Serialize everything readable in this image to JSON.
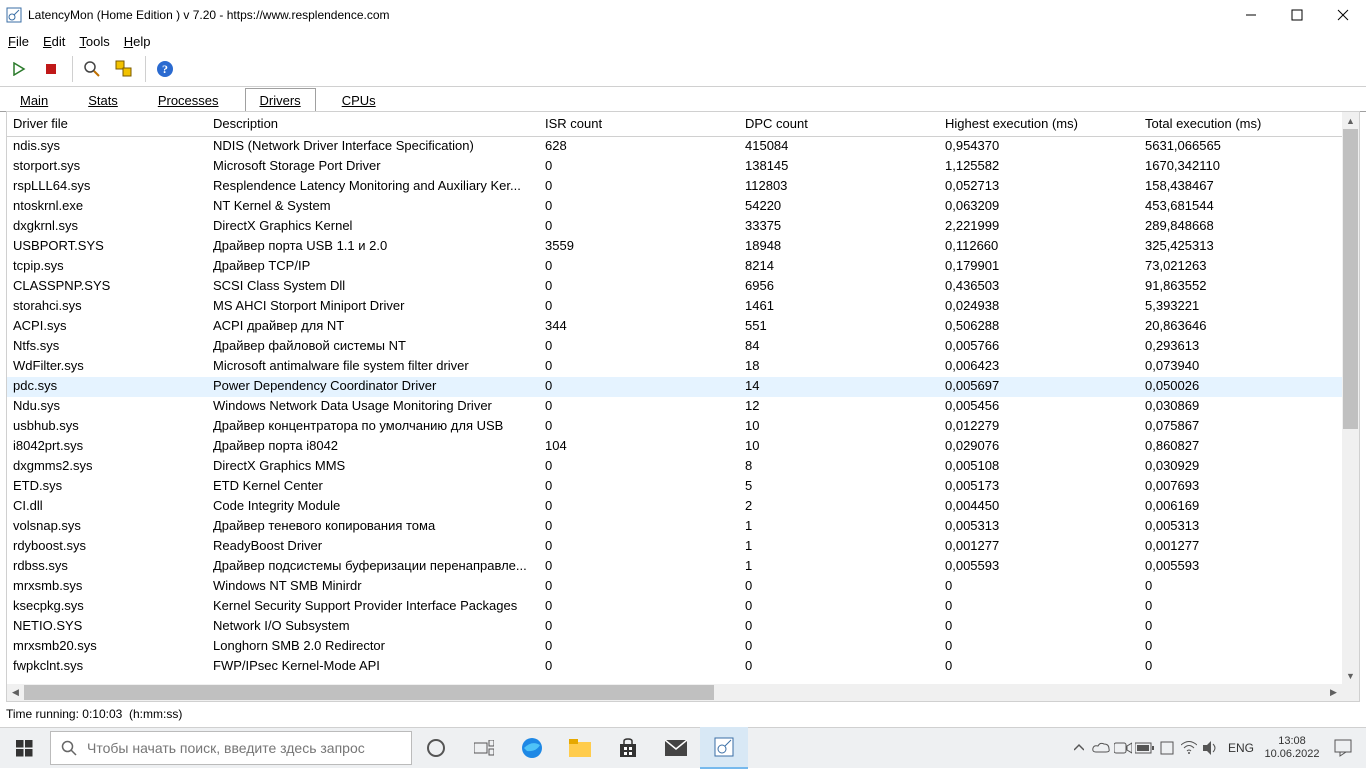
{
  "window": {
    "title": "LatencyMon  (Home Edition )  v 7.20 - https://www.resplendence.com"
  },
  "menu": {
    "items": [
      {
        "u": "F",
        "rest": "ile"
      },
      {
        "u": "E",
        "rest": "dit"
      },
      {
        "u": "T",
        "rest": "ools"
      },
      {
        "u": "H",
        "rest": "elp"
      }
    ]
  },
  "tabs": [
    {
      "label": "Main"
    },
    {
      "label": "Stats"
    },
    {
      "label": "Processes"
    },
    {
      "label": "Drivers"
    },
    {
      "label": "CPUs"
    }
  ],
  "active_tab": 3,
  "columns": [
    "Driver file",
    "Description",
    "ISR count",
    "DPC count",
    "Highest execution (ms)",
    "Total execution (ms)"
  ],
  "selected_row": 12,
  "rows": [
    [
      "ndis.sys",
      "NDIS (Network Driver Interface Specification)",
      "628",
      "415084",
      "0,954370",
      "5631,066565"
    ],
    [
      "storport.sys",
      "Microsoft Storage Port Driver",
      "0",
      "138145",
      "1,125582",
      "1670,342110"
    ],
    [
      "rspLLL64.sys",
      "Resplendence Latency Monitoring and Auxiliary Ker...",
      "0",
      "112803",
      "0,052713",
      "158,438467"
    ],
    [
      "ntoskrnl.exe",
      "NT Kernel & System",
      "0",
      "54220",
      "0,063209",
      "453,681544"
    ],
    [
      "dxgkrnl.sys",
      "DirectX Graphics Kernel",
      "0",
      "33375",
      "2,221999",
      "289,848668"
    ],
    [
      "USBPORT.SYS",
      "Драйвер порта USB 1.1 и 2.0",
      "3559",
      "18948",
      "0,112660",
      "325,425313"
    ],
    [
      "tcpip.sys",
      "Драйвер TCP/IP",
      "0",
      "8214",
      "0,179901",
      "73,021263"
    ],
    [
      "CLASSPNP.SYS",
      "SCSI Class System Dll",
      "0",
      "6956",
      "0,436503",
      "91,863552"
    ],
    [
      "storahci.sys",
      "MS AHCI Storport Miniport Driver",
      "0",
      "1461",
      "0,024938",
      "5,393221"
    ],
    [
      "ACPI.sys",
      "ACPI драйвер для NT",
      "344",
      "551",
      "0,506288",
      "20,863646"
    ],
    [
      "Ntfs.sys",
      "Драйвер файловой системы NT",
      "0",
      "84",
      "0,005766",
      "0,293613"
    ],
    [
      "WdFilter.sys",
      "Microsoft antimalware file system filter driver",
      "0",
      "18",
      "0,006423",
      "0,073940"
    ],
    [
      "pdc.sys",
      "Power Dependency Coordinator Driver",
      "0",
      "14",
      "0,005697",
      "0,050026"
    ],
    [
      "Ndu.sys",
      "Windows Network Data Usage Monitoring Driver",
      "0",
      "12",
      "0,005456",
      "0,030869"
    ],
    [
      "usbhub.sys",
      "Драйвер концентратора по умолчанию для USB",
      "0",
      "10",
      "0,012279",
      "0,075867"
    ],
    [
      "i8042prt.sys",
      "Драйвер порта i8042",
      "104",
      "10",
      "0,029076",
      "0,860827"
    ],
    [
      "dxgmms2.sys",
      "DirectX Graphics MMS",
      "0",
      "8",
      "0,005108",
      "0,030929"
    ],
    [
      "ETD.sys",
      "ETD Kernel Center",
      "0",
      "5",
      "0,005173",
      "0,007693"
    ],
    [
      "CI.dll",
      "Code Integrity Module",
      "0",
      "2",
      "0,004450",
      "0,006169"
    ],
    [
      "volsnap.sys",
      "Драйвер теневого копирования тома",
      "0",
      "1",
      "0,005313",
      "0,005313"
    ],
    [
      "rdyboost.sys",
      "ReadyBoost Driver",
      "0",
      "1",
      "0,001277",
      "0,001277"
    ],
    [
      "rdbss.sys",
      "Драйвер подсистемы буферизации перенаправле...",
      "0",
      "1",
      "0,005593",
      "0,005593"
    ],
    [
      "mrxsmb.sys",
      "Windows NT SMB Minirdr",
      "0",
      "0",
      "0",
      "0"
    ],
    [
      "ksecpkg.sys",
      "Kernel Security Support Provider Interface Packages",
      "0",
      "0",
      "0",
      "0"
    ],
    [
      "NETIO.SYS",
      "Network I/O Subsystem",
      "0",
      "0",
      "0",
      "0"
    ],
    [
      "mrxsmb20.sys",
      "Longhorn SMB 2.0 Redirector",
      "0",
      "0",
      "0",
      "0"
    ],
    [
      "fwpkclnt.sys",
      "FWP/IPsec Kernel-Mode API",
      "0",
      "0",
      "0",
      "0"
    ]
  ],
  "status": {
    "label": "Time running:",
    "value": "0:10:03",
    "hint": "(h:mm:ss)"
  },
  "taskbar": {
    "search_placeholder": "Чтобы начать поиск, введите здесь запрос",
    "lang": "ENG",
    "time": "13:08",
    "date": "10.06.2022"
  }
}
